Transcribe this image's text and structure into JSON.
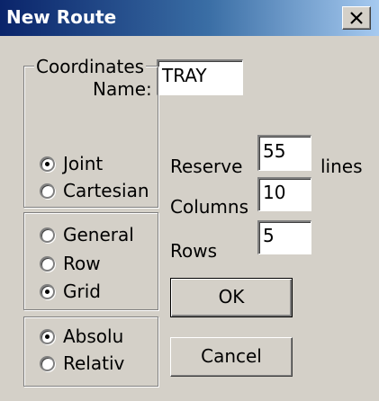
{
  "window": {
    "title": "New Route",
    "close_icon": "close-x-icon"
  },
  "name_field": {
    "label": "Name:",
    "value": "TRAY"
  },
  "coordinates_group": {
    "legend": "Coordinates",
    "options": [
      {
        "label": "Joint",
        "checked": true
      },
      {
        "label": "Cartesian",
        "checked": false
      }
    ]
  },
  "route_type_group": {
    "options": [
      {
        "label": "General",
        "checked": false
      },
      {
        "label": "Row",
        "checked": false
      },
      {
        "label": "Grid",
        "checked": true
      }
    ]
  },
  "mode_group": {
    "options": [
      {
        "label": "Absolu",
        "checked": true
      },
      {
        "label": "Relativ",
        "checked": false
      }
    ]
  },
  "reserve_field": {
    "label": "Reserve",
    "value": "55",
    "unit": "lines"
  },
  "columns_field": {
    "label": "Columns",
    "value": "10"
  },
  "rows_field": {
    "label": "Rows",
    "value": "5"
  },
  "buttons": {
    "ok_label": "OK",
    "cancel_label": "Cancel"
  }
}
